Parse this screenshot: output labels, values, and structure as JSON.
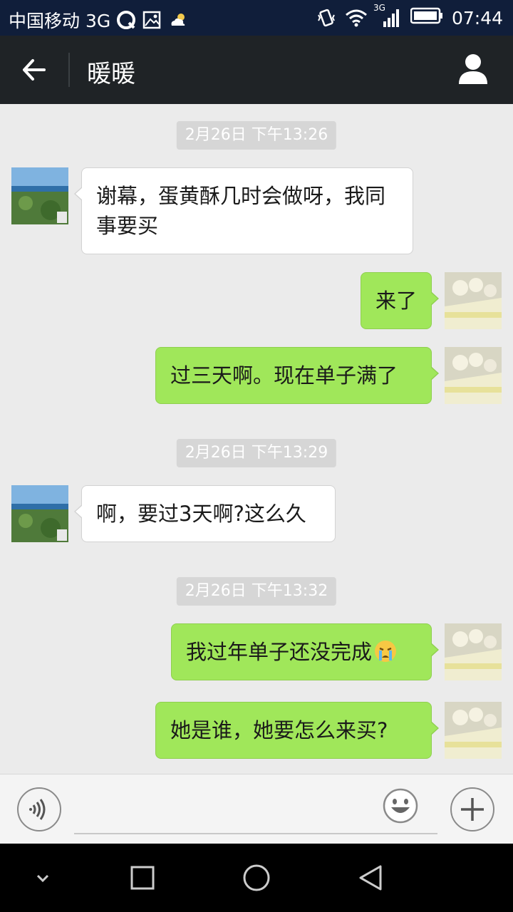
{
  "status_bar": {
    "carrier": "中国移动 3G",
    "network": "3G",
    "time": "07:44"
  },
  "header": {
    "back_icon": "arrow-left-icon",
    "title": "暖暖",
    "profile_icon": "person-icon"
  },
  "messages": [
    {
      "type": "timestamp",
      "text": "2月26日 下午13:26"
    },
    {
      "type": "incoming",
      "text": "谢幕，蛋黄酥几时会做呀，我同事要买"
    },
    {
      "type": "outgoing",
      "text": "来了"
    },
    {
      "type": "outgoing",
      "text": "过三天啊。现在单子满了"
    },
    {
      "type": "timestamp",
      "text": "2月26日 下午13:29"
    },
    {
      "type": "incoming",
      "text": "啊，要过3天啊?这么久"
    },
    {
      "type": "timestamp",
      "text": "2月26日 下午13:32"
    },
    {
      "type": "outgoing",
      "text": "我过年单子还没完成",
      "emoji": "crying-face-icon"
    },
    {
      "type": "outgoing",
      "text": "她是谁，她要怎么来买?"
    }
  ],
  "input_bar": {
    "voice_icon": "voice-icon",
    "emoji_icon": "smiley-icon",
    "plus_icon": "plus-icon",
    "text_value": ""
  },
  "nav_bar": {
    "icons": [
      "chevron-down-icon",
      "square-icon",
      "circle-icon",
      "triangle-back-icon"
    ]
  },
  "colors": {
    "status_bar_bg": "#101e3a",
    "title_bar_bg": "#1f2326",
    "chat_bg": "#ebebeb",
    "outgoing_bubble": "#a0e75a",
    "incoming_bubble": "#ffffff",
    "timestamp_bg": "#d6d6d6"
  }
}
